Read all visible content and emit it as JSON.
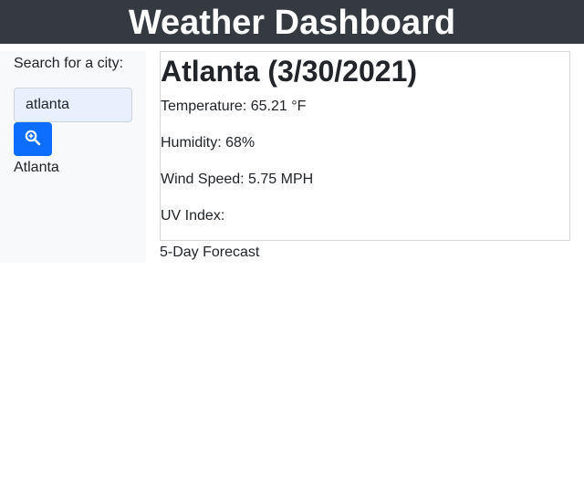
{
  "header": {
    "title": "Weather Dashboard"
  },
  "sidebar": {
    "search_label": "Search for a city:",
    "search_value": "atlanta",
    "search_button_icon": "search-zoom-icon",
    "history": [
      "Atlanta"
    ]
  },
  "current": {
    "title": "Atlanta (3/30/2021)",
    "temperature": "Temperature: 65.21 °F",
    "humidity": "Humidity: 68%",
    "wind": "Wind Speed: 5.75 MPH",
    "uv": "UV Index:"
  },
  "forecast": {
    "title": "5-Day Forecast"
  },
  "colors": {
    "header_bg": "#343a40",
    "sidebar_bg": "#f8f9fa",
    "button_bg": "#0d6efd",
    "input_bg": "#e8f0fe"
  }
}
